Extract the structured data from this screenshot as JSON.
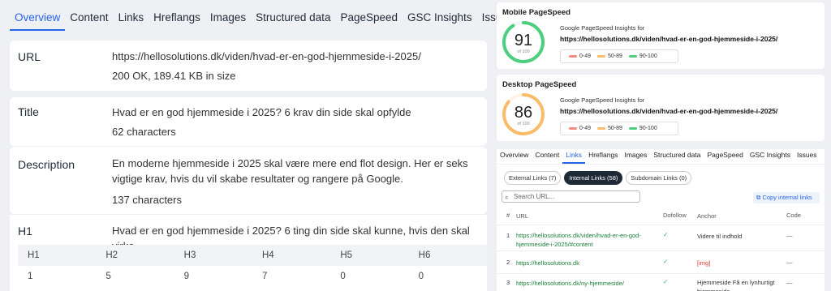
{
  "tabs": [
    "Overview",
    "Content",
    "Links",
    "Hreflangs",
    "Images",
    "Structured data",
    "PageSpeed",
    "GSC Insights",
    "Issues"
  ],
  "url_card": {
    "label": "URL",
    "url": "https://hellosolutions.dk/viden/hvad-er-en-god-hjemmeside-i-2025/",
    "status": "200 OK, 189.41 KB",
    "status_suffix": " in size"
  },
  "title_card": {
    "label": "Title",
    "value": "Hvad er en god hjemmeside i 2025? 6 krav din side skal opfylde",
    "chars": "62 characters"
  },
  "description_card": {
    "label": "Description",
    "value": "En moderne hjemmeside i 2025 skal være mere end flot design. Her er seks vigtige krav, hvis du vil skabe resultater og rangere på Google.",
    "chars": "137 characters"
  },
  "h1_card": {
    "label": "H1",
    "value": "Hvad er en god hjemmeside i 2025? 6 ting din side skal kunne, hvis den skal virke"
  },
  "headings": {
    "headers": [
      "H1",
      "H2",
      "H3",
      "H4",
      "H5",
      "H6"
    ],
    "counts": [
      "1",
      "5",
      "9",
      "7",
      "0",
      "0"
    ]
  },
  "mobile": {
    "title": "Mobile PageSpeed",
    "score": "91",
    "score_value": 91,
    "of": "of 100",
    "sub": "Google PageSpeed Insights for",
    "url": "https://hellosolutions.dk/viden/hvad-er-en-god-hjemmeside-i-2025/"
  },
  "desktop": {
    "title": "Desktop PageSpeed",
    "score": "86",
    "score_value": 86,
    "of": "of 100",
    "sub": "Google PageSpeed Insights for",
    "url": "https://hellosolutions.dk/viden/hvad-er-en-god-hjemmeside-i-2025/"
  },
  "legend": [
    {
      "label": "0-49",
      "color": "#f28b82"
    },
    {
      "label": "50-89",
      "color": "#fbbc6a"
    },
    {
      "label": "90-100",
      "color": "#4ccf7e"
    }
  ],
  "right_tabs": [
    "Overview",
    "Content",
    "Links",
    "Hreflangs",
    "Images",
    "Structured data",
    "PageSpeed",
    "GSC Insights",
    "Issues"
  ],
  "pills": [
    "External Links (7)",
    "Internal Links (58)",
    "Subdomain Links (0)"
  ],
  "search_placeholder": "Search URL...",
  "copy_label": "Copy internal links",
  "link_table": {
    "headers": [
      "#",
      "URL",
      "Dofollow",
      "Anchor",
      "Code"
    ],
    "rows": [
      {
        "n": "1",
        "url": "https://hellosolutions.dk/viden/hvad-er-en-god-hjemmeside-i-2025/#content",
        "dofollow": "✓",
        "anchor": "Videre til indhold",
        "code": "—"
      },
      {
        "n": "2",
        "url": "https://hellosolutions.dk",
        "dofollow": "✓",
        "anchor": "[img]",
        "code": "—"
      },
      {
        "n": "3",
        "url": "https://hellosolutions.dk/ny-hjemmeside/",
        "dofollow": "✓",
        "anchor": "Hjemmeside Få en lynhurtigt hjemmeside",
        "code": "—"
      }
    ]
  },
  "colors": {
    "accent": "#2563eb",
    "success": "#1db954",
    "img_anchor": "#e53935"
  }
}
